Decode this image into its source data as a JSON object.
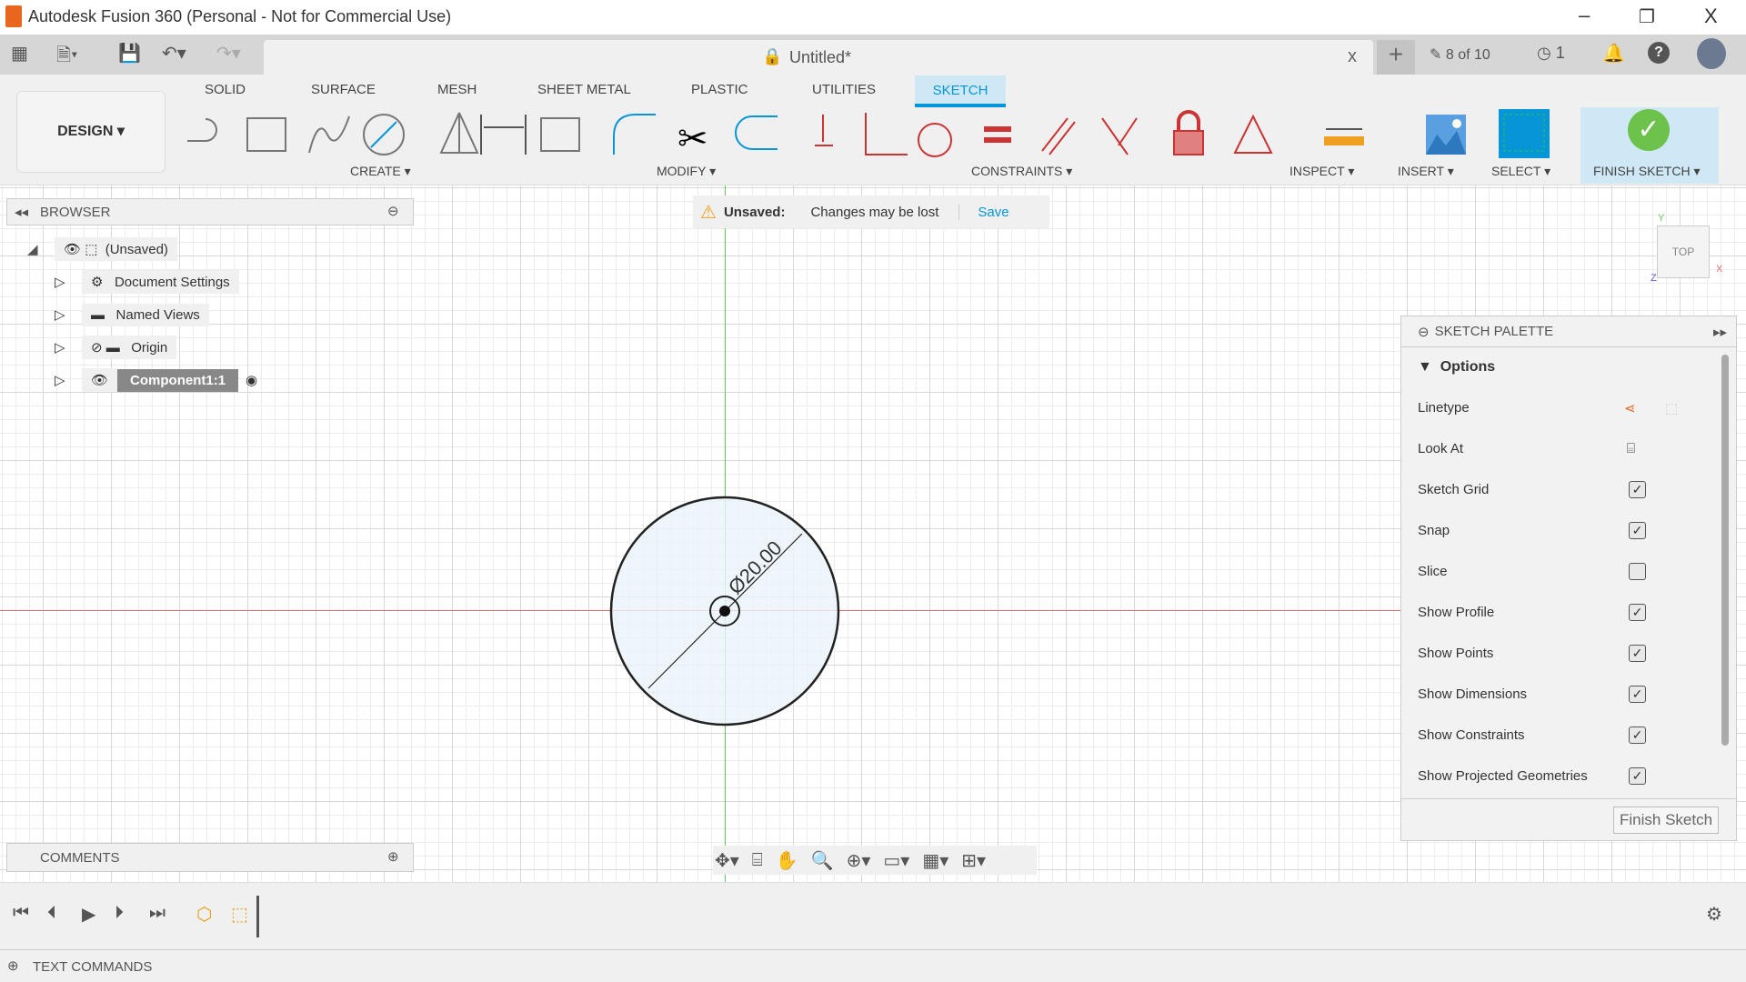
{
  "window": {
    "title": "Autodesk Fusion 360 (Personal - Not for Commercial Use)",
    "minimize": "–",
    "restore": "❐",
    "close": "X"
  },
  "tabbar": {
    "doc_title": "Untitled*",
    "close": "x",
    "new_tab": "+",
    "jobs": "8 of 10",
    "notifications_count": "1"
  },
  "ribbon": {
    "workspace": "DESIGN ▾",
    "tabs": [
      "SOLID",
      "SURFACE",
      "MESH",
      "SHEET METAL",
      "PLASTIC",
      "UTILITIES",
      "SKETCH"
    ],
    "active_tab": "SKETCH",
    "groups": {
      "create": "CREATE ▾",
      "modify": "MODIFY ▾",
      "constraints": "CONSTRAINTS ▾",
      "inspect": "INSPECT ▾",
      "insert": "INSERT ▾",
      "select": "SELECT ▾",
      "finish": "FINISH SKETCH ▾"
    },
    "accent": "#0696d7",
    "finish_color": "#6cc24a"
  },
  "banner": {
    "label": "Unsaved:",
    "message": "Changes may be lost",
    "save": "Save"
  },
  "browser": {
    "title": "BROWSER",
    "items": [
      {
        "label": "(Unsaved)"
      },
      {
        "label": "Document Settings"
      },
      {
        "label": "Named Views"
      },
      {
        "label": "Origin"
      },
      {
        "label": "Component1:1"
      }
    ]
  },
  "viewcube": {
    "face": "TOP",
    "x": "X",
    "y": "Y",
    "z": "Z"
  },
  "sketch": {
    "dimension": "Ø20.00"
  },
  "palette": {
    "title": "SKETCH PALETTE",
    "section": "Options",
    "rows": [
      {
        "label": "Linetype",
        "type": "icons"
      },
      {
        "label": "Look At",
        "type": "icon"
      },
      {
        "label": "Sketch Grid",
        "checked": true
      },
      {
        "label": "Snap",
        "checked": true
      },
      {
        "label": "Slice",
        "checked": false
      },
      {
        "label": "Show Profile",
        "checked": true
      },
      {
        "label": "Show Points",
        "checked": true
      },
      {
        "label": "Show Dimensions",
        "checked": true
      },
      {
        "label": "Show Constraints",
        "checked": true
      },
      {
        "label": "Show Projected Geometries",
        "checked": true
      }
    ],
    "finish": "Finish Sketch"
  },
  "comments": {
    "title": "COMMENTS"
  },
  "textcommands": {
    "title": "TEXT COMMANDS"
  }
}
